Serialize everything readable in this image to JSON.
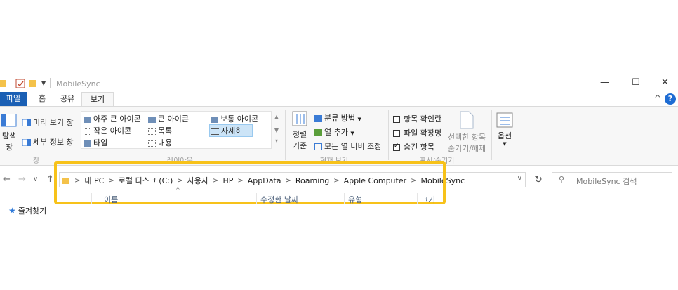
{
  "window": {
    "title": "MobileSync",
    "controls": {
      "minimize": "—",
      "maximize": "☐",
      "close": "✕"
    }
  },
  "ribbon_tabs": [
    "파일",
    "홈",
    "공유",
    "보기"
  ],
  "help": "?",
  "ribbon": {
    "panes": {
      "navigation_pane": [
        "탐색",
        "창"
      ],
      "preview_pane": "미리 보기 창",
      "details_pane": "세부 정보 창",
      "group_label": "창"
    },
    "layout": {
      "items": [
        "아주 큰 아이콘",
        "큰 아이콘",
        "보통 아이콘",
        "작은 아이콘",
        "목록",
        "자세히",
        "타일",
        "내용"
      ],
      "selected": "자세히",
      "group_label": "레이아웃"
    },
    "current_view": {
      "sort_by": [
        "정렬",
        "기준"
      ],
      "group_by": "분류 방법",
      "add_columns": "열 추가",
      "size_all_columns": "모든 열 너비 조정",
      "group_label": "현재 보기"
    },
    "show_hide": {
      "item_check_boxes": {
        "label": "항목 확인란",
        "checked": false
      },
      "file_name_extensions": {
        "label": "파일 확장명",
        "checked": false
      },
      "hidden_items": {
        "label": "숨긴 항목",
        "checked": true
      },
      "hide_selected": [
        "선택한 항목",
        "숨기기/해제"
      ],
      "group_label": "표시/숨기기"
    },
    "options": "옵션"
  },
  "address_bar": {
    "breadcrumbs": [
      "내 PC",
      "로컬 디스크 (C:)",
      "사용자",
      "HP",
      "AppData",
      "Roaming",
      "Apple Computer",
      "MobileSync"
    ]
  },
  "search": {
    "placeholder": "MobileSync 검색"
  },
  "columns": [
    "이름",
    "수정한 날짜",
    "유형",
    "크기"
  ],
  "nav_pane": {
    "quick_access": "즐겨찾기"
  },
  "colors": {
    "accent": "#1a5fb4",
    "highlight_box": "#f7c21a",
    "selection": "#cce4f7"
  }
}
